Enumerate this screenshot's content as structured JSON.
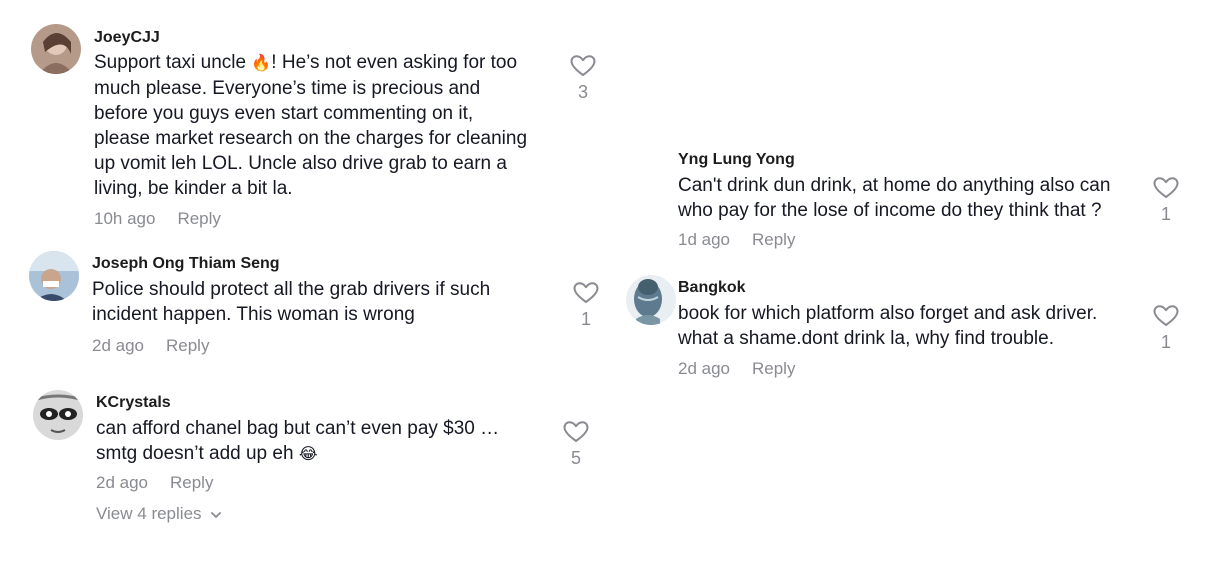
{
  "comments": [
    {
      "username": "JoeyCJJ",
      "text_before_emoji": "Support taxi uncle ",
      "emoji": "🔥",
      "text_lines": [
        "! He’s not even asking for too",
        "much please. Everyone’s time is precious and",
        "before you guys even start commenting on it,",
        "please market research on the charges for cleaning",
        "up vomit leh LOL. Uncle also drive grab to earn a",
        "living, be kinder a bit la."
      ],
      "time": "10h ago",
      "reply": "Reply",
      "likes": "3"
    },
    {
      "username": "Joseph Ong Thiam Seng",
      "text_lines": [
        "Police should protect all the grab drivers if such",
        "incident happen. This woman is wrong"
      ],
      "time": "2d ago",
      "reply": "Reply",
      "likes": "1"
    },
    {
      "username": "KCrystals",
      "text_lines": [
        "can afford chanel bag but can’t even pay $30 …",
        "smtg doesn’t add up eh "
      ],
      "emoji": "😂",
      "time": "2d ago",
      "reply": "Reply",
      "likes": "5",
      "view_replies": "View 4 replies"
    },
    {
      "username": "Yng Lung Yong",
      "text_lines": [
        "Can't drink dun drink, at home do anything also can",
        "who pay for the lose of income do they think that ?"
      ],
      "time": "1d ago",
      "reply": "Reply",
      "likes": "1"
    },
    {
      "username": "Bangkok",
      "text_lines": [
        "book for which platform also forget and ask driver.",
        "what a shame.dont drink la, why find trouble."
      ],
      "time": "2d ago",
      "reply": "Reply",
      "likes": "1"
    }
  ],
  "colors": {
    "text": "#161823",
    "meta": "#8a8b91"
  },
  "icons": [
    "heart-icon",
    "chevron-down-icon"
  ]
}
